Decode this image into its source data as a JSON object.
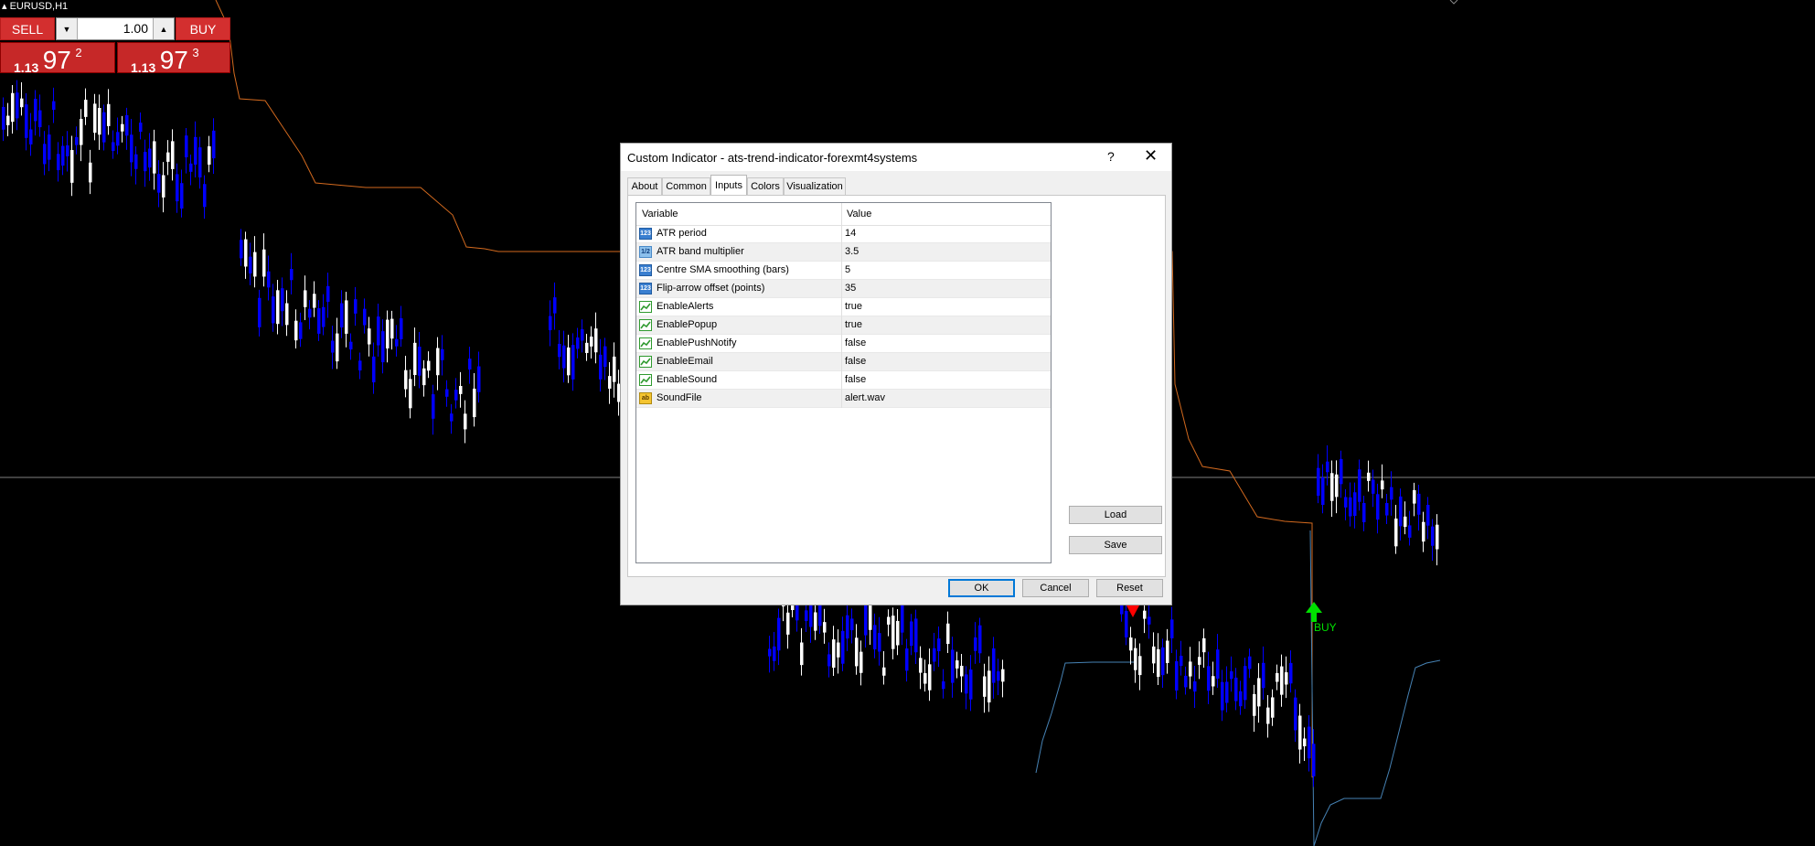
{
  "chart": {
    "symbol": "EURUSD,H1",
    "buy_signal_label": "BUY",
    "colors": {
      "background": "#000000",
      "bull_candle": "#ffffff",
      "bear_candle": "#0000ff",
      "upper_band": "#d2691e",
      "lower_band": "#4682b4",
      "price_line": "#808080",
      "buy_arrow": "#00e000",
      "sell_arrow": "#ff0000"
    }
  },
  "trade_panel": {
    "sell_label": "SELL",
    "buy_label": "BUY",
    "lot_value": "1.00",
    "lot_down_icon": "caret-down-icon",
    "lot_up_icon": "caret-up-icon",
    "sell_price": {
      "prefix": "1.13",
      "big": "97",
      "sup": "2"
    },
    "buy_price": {
      "prefix": "1.13",
      "big": "97",
      "sup": "3"
    }
  },
  "dialog": {
    "title": "Custom Indicator - ats-trend-indicator-forexmt4systems",
    "help_label": "?",
    "close_icon": "close-icon",
    "tabs": [
      {
        "label": "About"
      },
      {
        "label": "Common"
      },
      {
        "label": "Inputs",
        "active": true
      },
      {
        "label": "Colors"
      },
      {
        "label": "Visualization"
      }
    ],
    "grid": {
      "col_variable": "Variable",
      "col_value": "Value",
      "rows": [
        {
          "variable": "ATR period",
          "value": "14",
          "type": "int",
          "icon_text": "123"
        },
        {
          "variable": "ATR band multiplier",
          "value": "3.5",
          "type": "double",
          "icon_text": "1/2"
        },
        {
          "variable": "Centre SMA smoothing (bars)",
          "value": "5",
          "type": "int",
          "icon_text": "123"
        },
        {
          "variable": "Flip-arrow offset (points)",
          "value": "35",
          "type": "int",
          "icon_text": "123"
        },
        {
          "variable": "EnableAlerts",
          "value": "true",
          "type": "bool",
          "icon_text": ""
        },
        {
          "variable": "EnablePopup",
          "value": "true",
          "type": "bool",
          "icon_text": ""
        },
        {
          "variable": "EnablePushNotify",
          "value": "false",
          "type": "bool",
          "icon_text": ""
        },
        {
          "variable": "EnableEmail",
          "value": "false",
          "type": "bool",
          "icon_text": ""
        },
        {
          "variable": "EnableSound",
          "value": "false",
          "type": "bool",
          "icon_text": ""
        },
        {
          "variable": "SoundFile",
          "value": "alert.wav",
          "type": "string",
          "icon_text": "ab"
        }
      ]
    },
    "load_label": "Load",
    "save_label": "Save",
    "ok_label": "OK",
    "cancel_label": "Cancel",
    "reset_label": "Reset"
  }
}
